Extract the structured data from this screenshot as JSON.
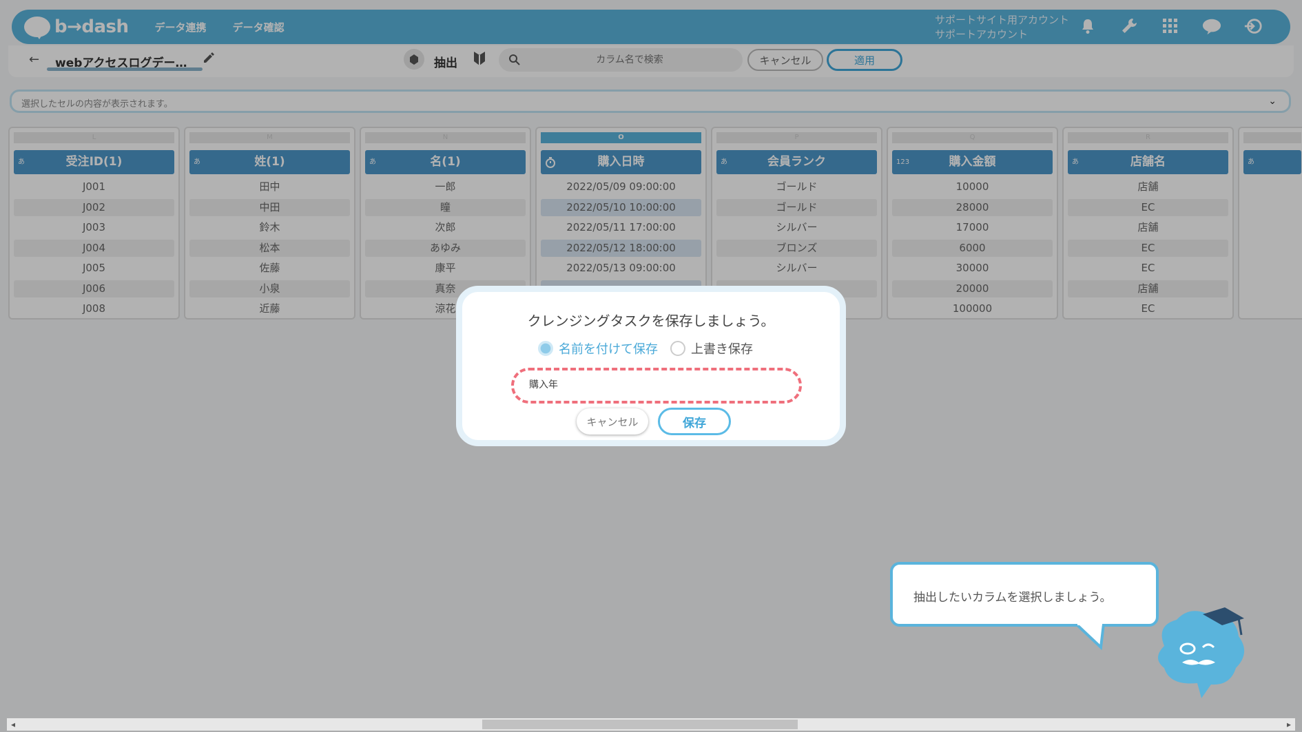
{
  "header": {
    "logo_text": "b→dash",
    "nav": [
      "データ連携",
      "データ確認"
    ],
    "account_line1": "サポートサイト用アカウント",
    "account_line2": "サポートアカウント",
    "icons": [
      "bell-icon",
      "wrench-icon",
      "grid-icon",
      "chat-icon",
      "logout-icon"
    ]
  },
  "toolbar": {
    "dataset_name": "webアクセスログデー…",
    "extract_label": "抽出",
    "search_placeholder": "カラム名で検索",
    "cancel_label": "キャンセル",
    "apply_label": "適用"
  },
  "cell_viewer": {
    "placeholder": "選択したセルの内容が表示されます。"
  },
  "columns": [
    {
      "letter": "L",
      "type": "あ",
      "name": "受注ID(1)",
      "selected": false,
      "cells": [
        "J001",
        "J002",
        "J003",
        "J004",
        "J005",
        "J006",
        "J008"
      ]
    },
    {
      "letter": "M",
      "type": "あ",
      "name": "姓(1)",
      "selected": false,
      "cells": [
        "田中",
        "中田",
        "鈴木",
        "松本",
        "佐藤",
        "小泉",
        "近藤"
      ]
    },
    {
      "letter": "N",
      "type": "あ",
      "name": "名(1)",
      "selected": false,
      "cells": [
        "一郎",
        "瞳",
        "次郎",
        "あゆみ",
        "康平",
        "真奈",
        "涼花"
      ]
    },
    {
      "letter": "O",
      "type": "clock",
      "name": "購入日時",
      "selected": true,
      "cells": [
        "2022/05/09 09:00:00",
        "2022/05/10 10:00:00",
        "2022/05/11 17:00:00",
        "2022/05/12 18:00:00",
        "2022/05/13 09:00:00",
        "",
        ""
      ]
    },
    {
      "letter": "P",
      "type": "あ",
      "name": "会員ランク",
      "selected": false,
      "cells": [
        "ゴールド",
        "ゴールド",
        "シルバー",
        "ブロンズ",
        "シルバー",
        "",
        ""
      ]
    },
    {
      "letter": "Q",
      "type": "123",
      "name": "購入金額",
      "selected": false,
      "cells": [
        "10000",
        "28000",
        "17000",
        "6000",
        "30000",
        "20000",
        "100000"
      ]
    },
    {
      "letter": "R",
      "type": "あ",
      "name": "店舗名",
      "selected": false,
      "cells": [
        "店舗",
        "EC",
        "店舗",
        "EC",
        "EC",
        "店舗",
        "EC"
      ]
    }
  ],
  "modal": {
    "title": "クレンジングタスクを保存しましょう。",
    "option_save_as": "名前を付けて保存",
    "option_overwrite": "上書き保存",
    "name_value": "購入年",
    "cancel_label": "キャンセル",
    "save_label": "保存"
  },
  "tooltip": {
    "text": "抽出したいカラムを選択しましょう。"
  },
  "colors": {
    "brand": "#5ab4dc",
    "header_col": "#4c97c9",
    "highlight_dashed": "#ef6f7c"
  }
}
